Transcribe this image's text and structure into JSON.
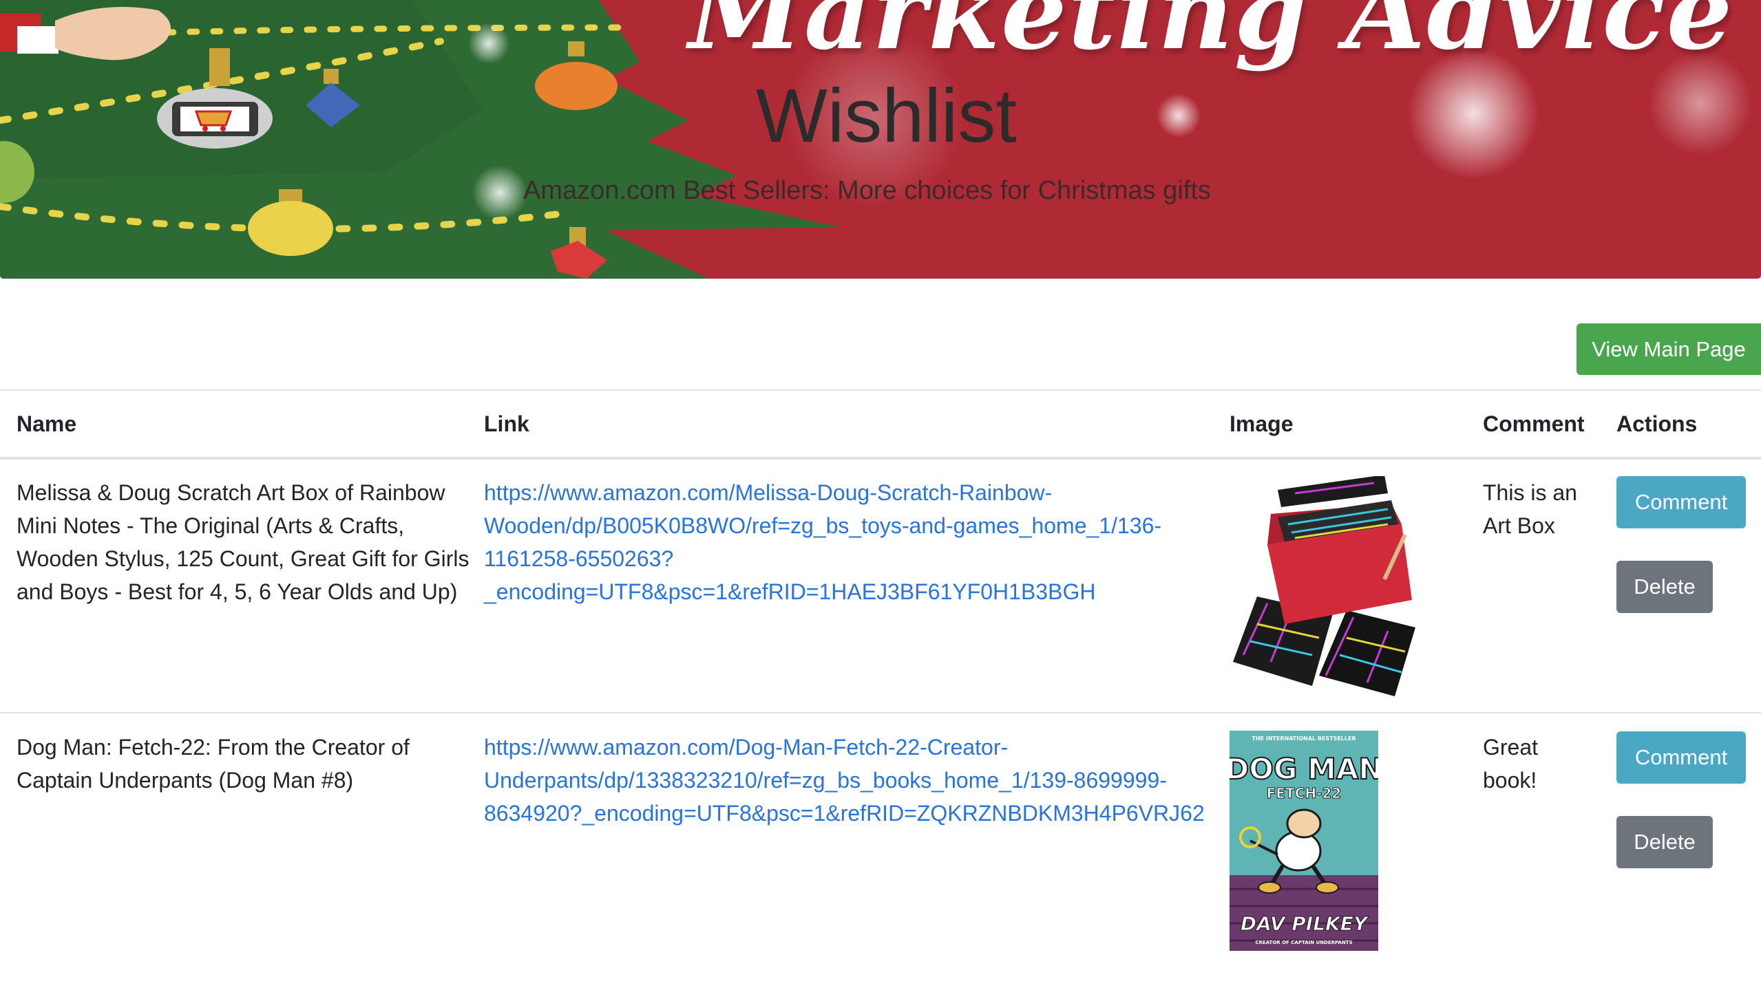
{
  "banner": {
    "script_text": "Marketing Advice",
    "title": "Wishlist",
    "subtitle": "Amazon.com Best Sellers: More choices for Christmas gifts"
  },
  "toolbar": {
    "view_main_label": "View Main Page"
  },
  "table": {
    "headers": {
      "name": "Name",
      "link": "Link",
      "image": "Image",
      "comment": "Comment",
      "actions": "Actions"
    },
    "rows": [
      {
        "name_lines": [
          "Melissa & Doug Scratch Art Box of Rainbow",
          "Mini Notes - The Original (Arts & Crafts,",
          "Wooden Stylus, 125 Count, Great Gift for Girls",
          "and Boys - Best for 4, 5, 6 Year Olds and Up)"
        ],
        "link_lines": [
          "https://www.amazon.com/Melissa-Doug-Scratch-Rainbow-",
          "Wooden/dp/B005K0B8WO/ref=zg_bs_toys-and-games_home_1/136-",
          "1161258-6550263?",
          "_encoding=UTF8&psc=1&refRID=1HAEJ3BF61YF0H1B3BGH"
        ],
        "comment_lines": [
          "This is an",
          "Art Box"
        ],
        "comment_button": "Comment",
        "delete_button": "Delete"
      },
      {
        "name_lines": [
          "Dog Man: Fetch-22: From the Creator of",
          "Captain Underpants (Dog Man #8)"
        ],
        "link_lines": [
          "https://www.amazon.com/Dog-Man-Fetch-22-Creator-",
          "Underpants/dp/1338323210/ref=zg_bs_books_home_1/139-8699999-",
          "8634920?_encoding=UTF8&psc=1&refRID=ZQKRZNBDKM3H4P6VRJ62"
        ],
        "comment_lines": [
          "Great",
          "book!"
        ],
        "comment_button": "Comment",
        "delete_button": "Delete",
        "image_text": {
          "top": "THE INTERNATIONAL BESTSELLER",
          "title": "DOG MAN",
          "subtitle": "FETCH-22",
          "author": "DAV PILKEY",
          "byline": "CREATOR OF CAPTAIN UNDERPANTS"
        }
      }
    ]
  },
  "colors": {
    "banner_red": "#b02a36",
    "tree_green": "#2e6b34",
    "success": "#4aa54f",
    "info": "#4aa8c4",
    "secondary": "#6d747b",
    "link": "#2a73d9"
  }
}
